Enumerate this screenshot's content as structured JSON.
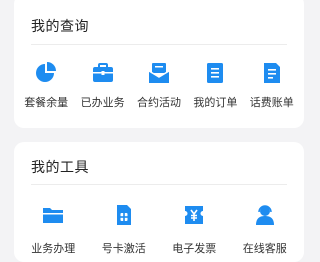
{
  "colors": {
    "accent": "#1e8cf0",
    "background": "#f3f3f5",
    "card": "#ffffff"
  },
  "query_section": {
    "title": "我的查询",
    "items": [
      {
        "label": "套餐余量",
        "icon": "pie-chart-icon"
      },
      {
        "label": "已办业务",
        "icon": "briefcase-icon"
      },
      {
        "label": "合约活动",
        "icon": "envelope-icon"
      },
      {
        "label": "我的订单",
        "icon": "order-list-icon"
      },
      {
        "label": "话费账单",
        "icon": "bill-icon"
      }
    ]
  },
  "tools_section": {
    "title": "我的工具",
    "items": [
      {
        "label": "业务办理",
        "icon": "folder-icon"
      },
      {
        "label": "号卡激活",
        "icon": "sim-card-icon"
      },
      {
        "label": "电子发票",
        "icon": "yen-ticket-icon"
      },
      {
        "label": "在线客服",
        "icon": "customer-service-icon"
      }
    ]
  }
}
